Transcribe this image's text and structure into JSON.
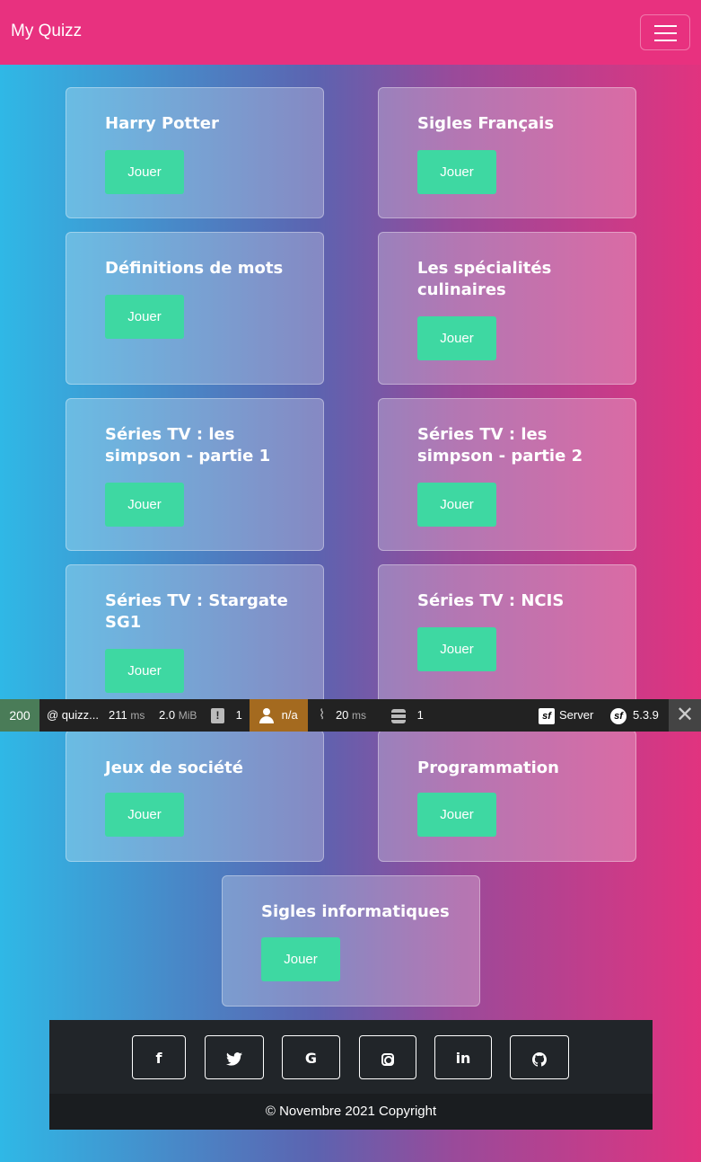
{
  "navbar": {
    "brand": "My Quizz"
  },
  "quizzes": [
    {
      "title": "Harry Potter",
      "button": "Jouer"
    },
    {
      "title": "Sigles Français",
      "button": "Jouer"
    },
    {
      "title": "Définitions de mots",
      "button": "Jouer"
    },
    {
      "title": "Les spécialités culinaires",
      "button": "Jouer"
    },
    {
      "title": "Séries TV : les simpson - partie 1",
      "button": "Jouer"
    },
    {
      "title": "Séries TV : les simpson - partie 2",
      "button": "Jouer"
    },
    {
      "title": "Séries TV : Stargate SG1",
      "button": "Jouer"
    },
    {
      "title": "Séries TV : NCIS",
      "button": "Jouer"
    },
    {
      "title": "Jeux de société",
      "button": "Jouer"
    },
    {
      "title": "Programmation",
      "button": "Jouer"
    },
    {
      "title": "Sigles informatiques",
      "button": "Jouer"
    }
  ],
  "debugbar": {
    "status": "200",
    "route": "@ quizz...",
    "time_value": "211",
    "time_unit": "ms",
    "memory_value": "2.0",
    "memory_unit": "MiB",
    "logs_count": "1",
    "user": "n/a",
    "twig_value": "20",
    "twig_unit": "ms",
    "db_count": "1",
    "server_label": "Server",
    "version": "5.3.9",
    "colors": {
      "status": "#4a7c58",
      "user": "#a46a1f"
    }
  },
  "footer": {
    "social": [
      "facebook-icon",
      "twitter-icon",
      "google-icon",
      "instagram-icon",
      "linkedin-icon",
      "github-icon"
    ],
    "copyright": "© Novembre 2021 Copyright"
  },
  "colors": {
    "navbar": "#e8317f",
    "button": "#3ed8a2",
    "footer": "#212529"
  }
}
